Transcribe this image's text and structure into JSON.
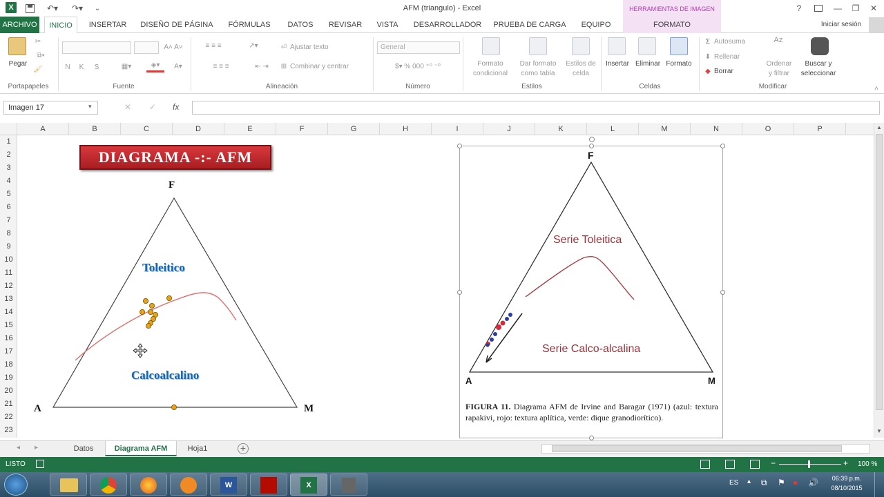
{
  "window": {
    "title": "AFM (triangulo) - Excel",
    "context_group": "HERRAMIENTAS DE IMAGEN",
    "help": "?",
    "sign_in": "Iniciar sesión"
  },
  "tabs": [
    "ARCHIVO",
    "INICIO",
    "INSERTAR",
    "DISEÑO DE PÁGINA",
    "FÓRMULAS",
    "DATOS",
    "REVISAR",
    "VISTA",
    "DESARROLLADOR",
    "PRUEBA DE CARGA",
    "EQUIPO",
    "FORMATO"
  ],
  "ribbon": {
    "groups": [
      "Portapapeles",
      "Fuente",
      "Alineación",
      "Número",
      "Estilos",
      "Celdas",
      "Modificar"
    ],
    "pegar": "Pegar",
    "ajustar_texto": "Ajustar texto",
    "combinar": "Combinar y centrar",
    "number_format": "General",
    "formato_condicional": [
      "Formato",
      "condicional"
    ],
    "dar_formato": [
      "Dar formato",
      "como tabla"
    ],
    "estilos_celda": [
      "Estilos de",
      "celda"
    ],
    "insertar": "Insertar",
    "eliminar": "Eliminar",
    "formato": "Formato",
    "autosuma": "Autosuma",
    "rellenar": "Rellenar",
    "borrar": "Borrar",
    "ordenar": [
      "Ordenar",
      "y filtrar"
    ],
    "buscar": [
      "Buscar y",
      "seleccionar"
    ],
    "font_buttons": [
      "N",
      "K",
      "S"
    ]
  },
  "namebox": "Imagen 17",
  "fx": "fx",
  "columns": [
    "A",
    "B",
    "C",
    "D",
    "E",
    "F",
    "G",
    "H",
    "I",
    "J",
    "K",
    "L",
    "M",
    "N",
    "O",
    "P"
  ],
  "rows": [
    "1",
    "2",
    "3",
    "4",
    "5",
    "6",
    "7",
    "8",
    "9",
    "10",
    "11",
    "12",
    "13",
    "14",
    "15",
    "16",
    "17",
    "18",
    "19",
    "20",
    "21",
    "22",
    "23"
  ],
  "left_diagram": {
    "banner": "DIAGRAMA -:- AFM",
    "F": "F",
    "A": "A",
    "M": "M",
    "toleitico": "Toleitico",
    "calcoalcalino": "Calcoalcalino"
  },
  "right_image": {
    "F": "F",
    "A": "A",
    "M": "M",
    "serie_toleitica": "Serie Toleitica",
    "serie_calco": "Serie Calco-alcalina",
    "caption_bold": "FIGURA 11.",
    "caption": "Diagrama AFM de Irvine and Baragar (1971) (azul: textura rapakivi, rojo: textura aplítica, verde: dique granodiorítico)."
  },
  "sheets": [
    "Datos",
    "Diagrama AFM",
    "Hoja1"
  ],
  "status": {
    "left": "LISTO",
    "zoom": "100 %"
  },
  "taskbar": {
    "lang": "ES",
    "time": "06:39 p.m.",
    "date": "08/10/2015"
  },
  "colors": {
    "excel_green": "#217346",
    "banner_red": "#c0282c",
    "curve": "#e07070",
    "point": "#e5a21c",
    "blue_label": "#1565b0",
    "dark_red_label": "#a0323a"
  }
}
